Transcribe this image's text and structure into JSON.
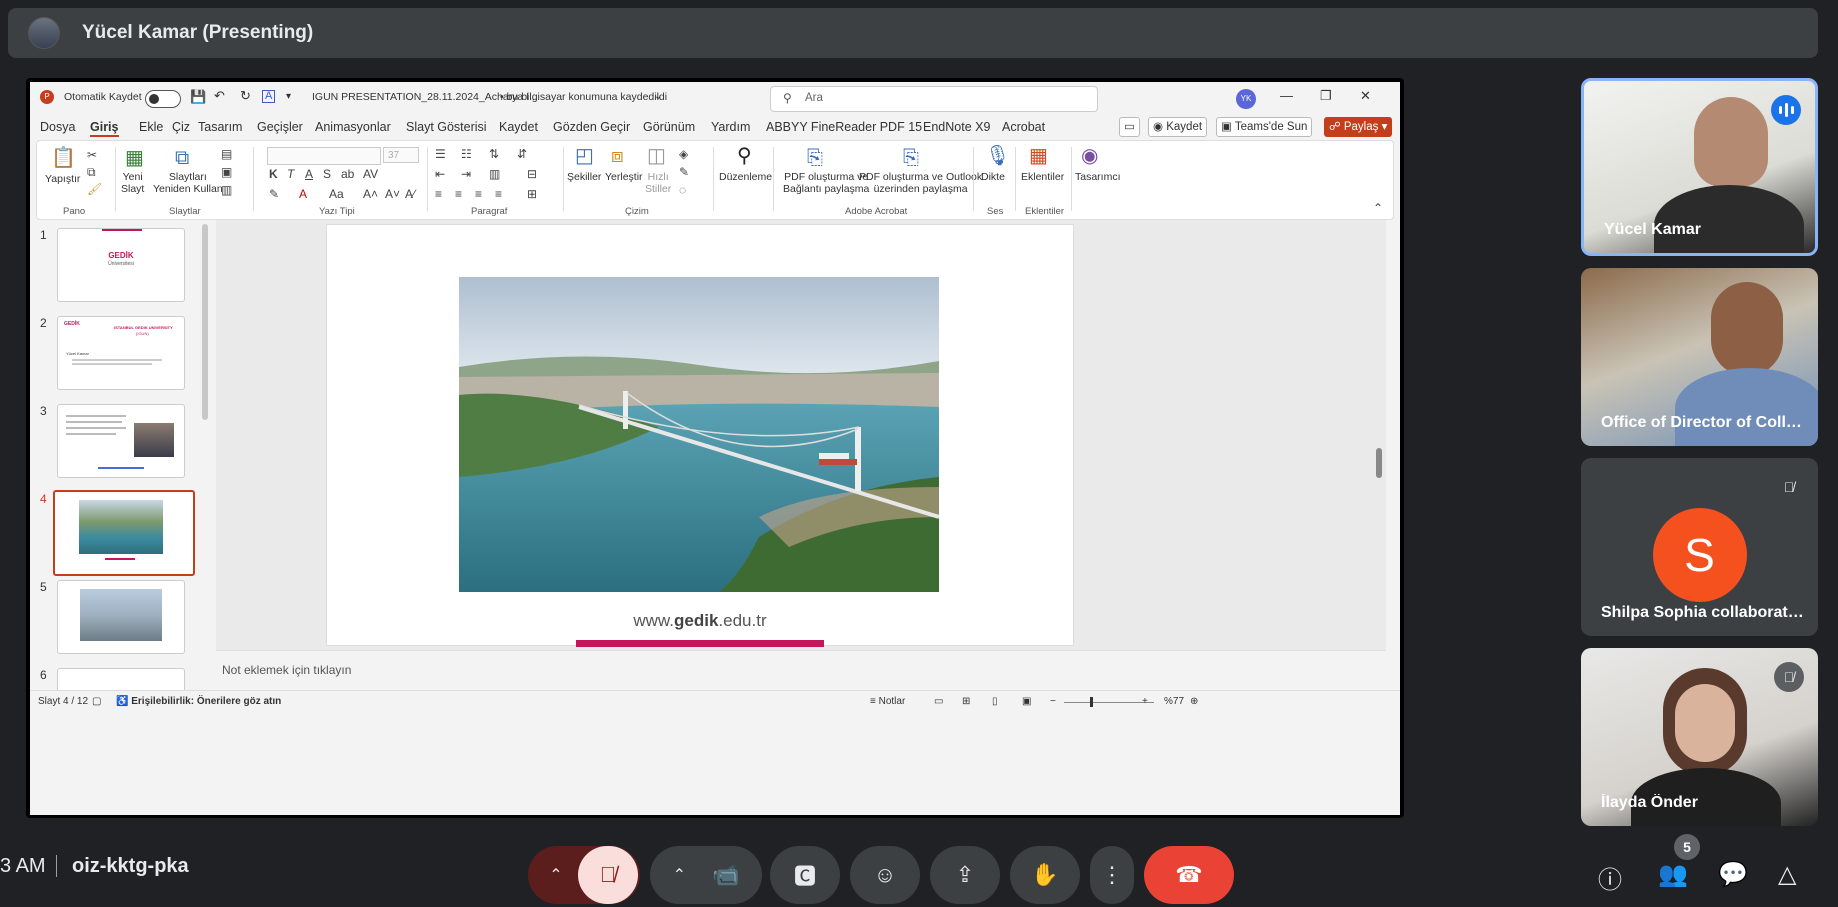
{
  "presenter_bar": {
    "title": "Yücel Kamar (Presenting)"
  },
  "ppt": {
    "titlebar": {
      "autosave": "Otomatik Kaydet",
      "filename": "IGUN PRESENTATION_28.11.2024_Acharya I...",
      "saved": "• bu bilgisayar konumuna kaydedildi",
      "search_placeholder": "Ara",
      "user_initials": "YK"
    },
    "menu": [
      "Dosya",
      "Giriş",
      "Ekle",
      "Çiz",
      "Tasarım",
      "Geçişler",
      "Animasyonlar",
      "Slayt Gösterisi",
      "Kaydet",
      "Gözden Geçir",
      "Görünüm",
      "Yardım",
      "ABBYY FineReader PDF 15",
      "EndNote X9",
      "Acrobat"
    ],
    "menu_right": {
      "record": "Kaydet",
      "teams": "Teams'de Sun",
      "share": "Paylaş"
    },
    "ribbon": {
      "paste": "Yapıştır",
      "new_slide": "Yeni\nSlayt",
      "reuse_slides": "Slaytları\nYeniden Kullan",
      "font_size": "37",
      "shapes": "Şekiller",
      "arrange": "Yerleştir",
      "quick_styles": "Hızlı\nStiller",
      "editing": "Düzenleme",
      "pdf_share": "PDF oluşturma ve\nBağlantı paylaşma",
      "pdf_outlook": "PDF oluşturma ve Outlook\nüzerinden paylaşma",
      "dictate": "Dikte",
      "addins": "Eklentiler",
      "designer": "Tasarımcı",
      "groups": {
        "clipboard": "Pano",
        "slides": "Slaytlar",
        "font": "Yazı Tipi",
        "paragraph": "Paragraf",
        "drawing": "Çizim",
        "adobe": "Adobe Acrobat",
        "voice": "Ses",
        "addins": "Eklentiler"
      }
    },
    "thumbnails": [
      "1",
      "2",
      "3",
      "4",
      "5",
      "6"
    ],
    "thumb_texts": {
      "t1_logo": "GEDİK",
      "t1_sub": "Üniversitesi",
      "t2_title": "ISTANBUL GEDIK UNIVERSITY",
      "t2_sub": "(IGUN)",
      "t2_name": "Yücel Kamar",
      "t2_logo": "GEDİK"
    },
    "slide": {
      "url_prefix": "www.",
      "url_bold": "gedik",
      "url_suffix": ".edu.tr"
    },
    "notes_placeholder": "Not eklemek için tıklayın",
    "status": {
      "slide_count": "Slayt 4 / 12",
      "accessibility": "Erişilebilirlik: Önerilere göz atın",
      "notes": "Notlar",
      "zoom": "%77"
    }
  },
  "participants": [
    {
      "name": "Yücel Kamar",
      "speaking": true
    },
    {
      "name": "Office of Director of Collaboration",
      "speaking": false
    },
    {
      "name": "Shilpa Sophia collaboration",
      "avatar_letter": "S",
      "muted": true
    },
    {
      "name": "İlayda Önder",
      "muted": true
    }
  ],
  "bottom_bar": {
    "time": "3 AM",
    "meeting_code": "oiz-kktg-pka",
    "people_count": "5"
  },
  "colors": {
    "accent": "#8ab4f8",
    "hangup": "#ea4335",
    "ppt_accent": "#c43e1c",
    "brand_pink": "#c2185b"
  }
}
